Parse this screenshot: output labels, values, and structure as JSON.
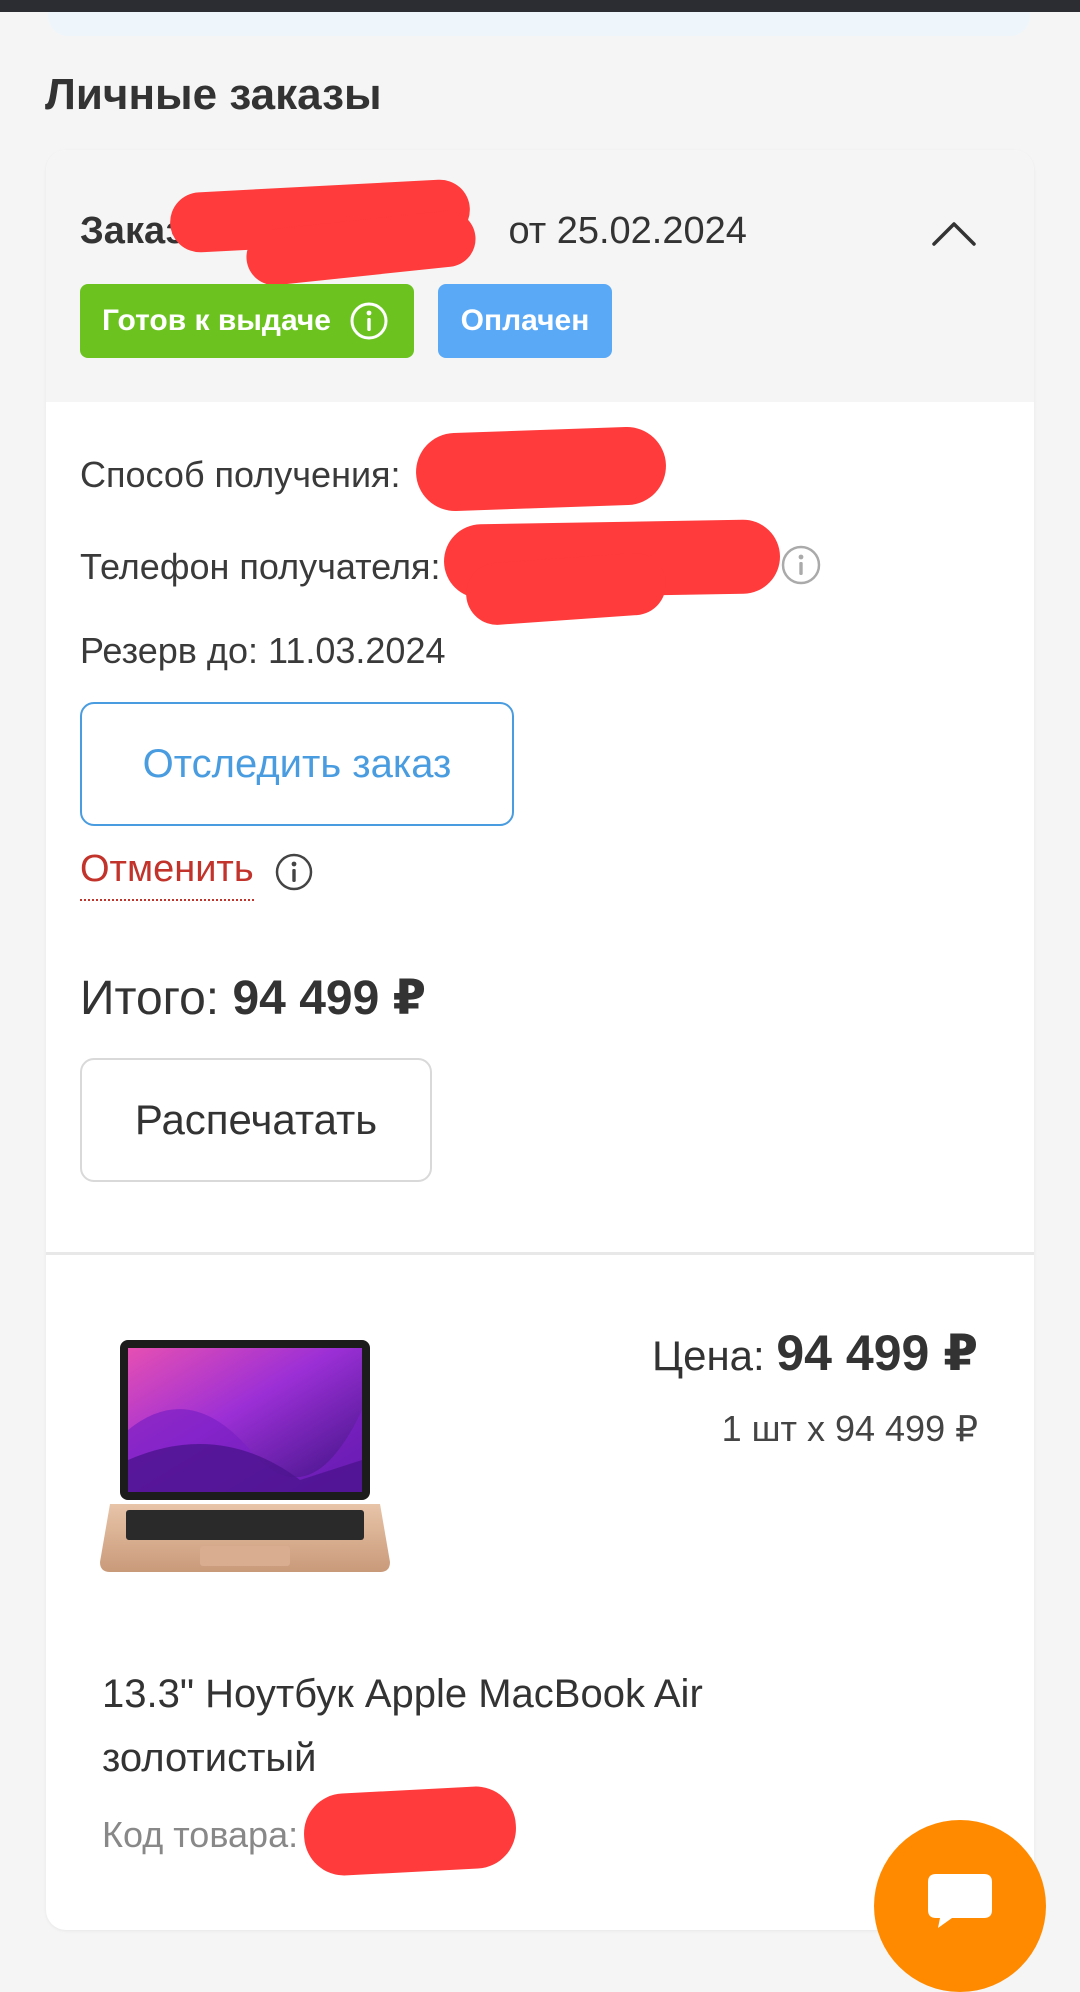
{
  "page": {
    "section_title": "Личные заказы"
  },
  "order": {
    "title_word": "Заказ",
    "date_text": "от 25.02.2024",
    "badges": {
      "ready": "Готов к выдаче",
      "paid": "Оплачен"
    },
    "details": {
      "receive_label": "Способ получения:",
      "phone_label": "Телефон получателя:",
      "reserve_label": "Резерв до:",
      "reserve_date": "11.03.2024"
    },
    "actions": {
      "track": "Отследить заказ",
      "cancel": "Отменить",
      "print": "Распечатать"
    },
    "total": {
      "label": "Итого:",
      "value": "94 499 ₽"
    }
  },
  "product": {
    "price_label": "Цена:",
    "price_value": "94 499 ₽",
    "qty_line": "1 шт x 94 499 ₽",
    "name": "13.3\" Ноутбук Apple MacBook Air золотистый",
    "sku_label": "Код товара:"
  },
  "colors": {
    "ready_badge": "#6cc31f",
    "paid_badge": "#5aa9f7",
    "link_blue": "#4a9ce0",
    "cancel_red": "#c2332b",
    "chat_orange": "#ff8a00",
    "redaction": "#ff3b3b"
  },
  "icons": [
    "info-icon",
    "chevron-up-icon",
    "chat-icon",
    "laptop-image"
  ]
}
